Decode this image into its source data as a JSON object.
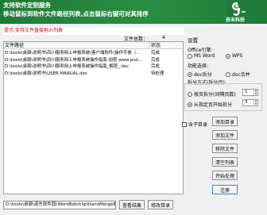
{
  "header": {
    "line1": "支持软件定制服务",
    "line2": "移动鼠标到软件文件路径列表,点击鼠标右键可对其排序",
    "brand": "奈末科技"
  },
  "notice": "提示:支持文件直接拖入列表",
  "file_count": {
    "label": "文件总数：",
    "value": "4"
  },
  "table": {
    "columns": [
      "文件路径",
      "状态"
    ],
    "rows": [
      {
        "path": "D:\\tools\\桌面\\说明书\\四川服务网上申报系统(客户端软件)操作手册（...",
        "status": "完成"
      },
      {
        "path": "D:\\tools\\桌面\\说明书\\四川服务网上申报系统操作指南-加密-www.pcd...",
        "status": "完成"
      },
      {
        "path": "D:\\tools\\桌面\\说明书\\四川服务网上申报系统操作指南_解密_.doc",
        "status": "完成"
      },
      {
        "path": "D:\\tools\\桌面\\说明书\\USER MANUAL.doc",
        "status": "待处理"
      }
    ]
  },
  "settings": {
    "title": "设置",
    "office_label": "Office引擎:",
    "engine_options": [
      "MS Word",
      "WPS"
    ],
    "engine_selected": "WPS",
    "function_label": "功能选择:",
    "function_options": [
      "doc拆分",
      "doc合并"
    ],
    "function_selected": "doc拆分",
    "split_mode_label": "拆分方式(拆分页):",
    "split_options": [
      "按页拆分(间隔页数)",
      "从指定页开始拆分"
    ],
    "split_selected": "从指定页开始拆分",
    "spin_value_1": "1",
    "spin_value_2": "3"
  },
  "include_subdirs": "含子目录",
  "buttons": {
    "add_dir": "添加目录",
    "add_file": "添加文件",
    "remove_file": "移除文件",
    "clear_list": "清空列表",
    "start": "开始处理",
    "register": "注册",
    "view_result": "查看结果",
    "modify_dir": "修改目录"
  },
  "output_path": "D:\\tools\\桌面\\诺东软件园(WordBatchSplitandMerge83",
  "colors": {
    "header_green": "#2a8d42",
    "notice_red": "#cc0000",
    "primary_border": "#3c7fd0"
  }
}
